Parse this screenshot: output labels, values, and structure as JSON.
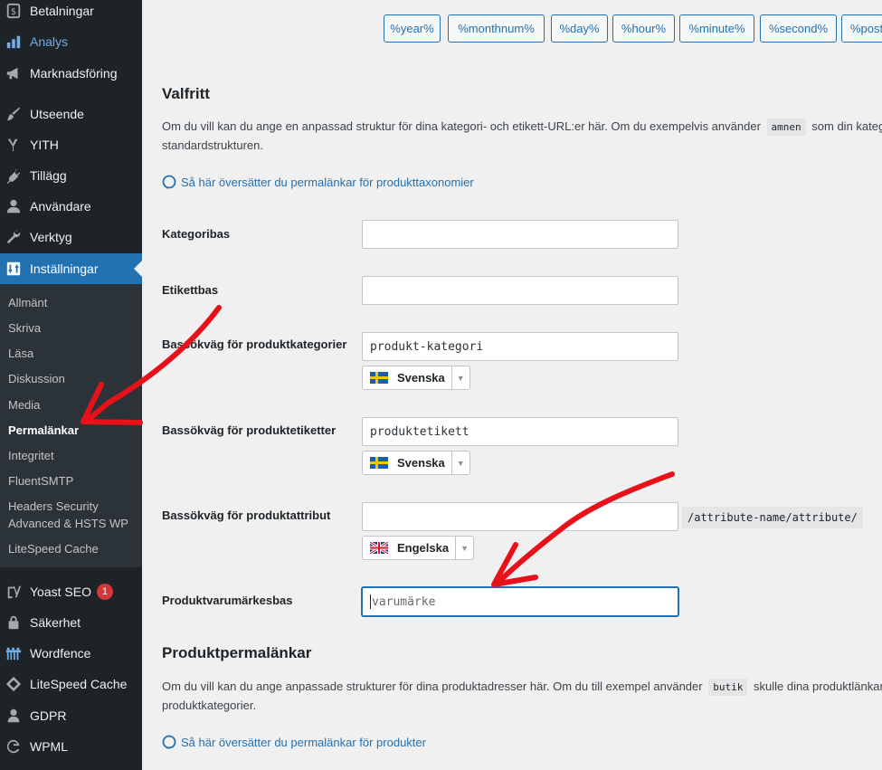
{
  "sidebar": {
    "top_items": [
      {
        "label": "Betalningar",
        "icon": "dollar-icon"
      },
      {
        "label": "Analys",
        "icon": "chart-bar-icon"
      },
      {
        "label": "Marknadsföring",
        "icon": "megaphone-icon"
      },
      {
        "label": "Utseende",
        "icon": "paintbrush-icon"
      },
      {
        "label": "YITH",
        "icon": "yith-icon"
      },
      {
        "label": "Tillägg",
        "icon": "plugin-icon"
      },
      {
        "label": "Användare",
        "icon": "users-icon"
      },
      {
        "label": "Verktyg",
        "icon": "wrench-icon"
      },
      {
        "label": "Inställningar",
        "icon": "settings-icon"
      }
    ],
    "submenu": [
      "Allmänt",
      "Skriva",
      "Läsa",
      "Diskussion",
      "Media",
      "Permalänkar",
      "Integritet",
      "FluentSMTP",
      "Headers Security Advanced & HSTS WP",
      "LiteSpeed Cache"
    ],
    "bottom_items": [
      {
        "label": "Yoast SEO",
        "icon": "yoast-icon",
        "badge": "1"
      },
      {
        "label": "Säkerhet",
        "icon": "lock-icon"
      },
      {
        "label": "Wordfence",
        "icon": "wordfence-icon"
      },
      {
        "label": "LiteSpeed Cache",
        "icon": "diamond-icon"
      },
      {
        "label": "GDPR",
        "icon": "person-icon"
      },
      {
        "label": "WPML",
        "icon": "wpml-icon"
      }
    ]
  },
  "tags": [
    "%year%",
    "%monthnum%",
    "%day%",
    "%hour%",
    "%minute%",
    "%second%",
    "%post"
  ],
  "optional": {
    "heading": "Valfritt",
    "desc_line1_before": "Om du vill kan du ange en anpassad struktur för dina kategori- och etikett-URL:er här. Om du exempelvis använder",
    "desc_code": "amnen",
    "desc_line1_after": "som din kateg",
    "desc_line2": "standardstrukturen.",
    "help_link": "Så här översätter du permalänkar för produkttaxonomier"
  },
  "fields": {
    "kategoribas": {
      "label": "Kategoribas",
      "value": ""
    },
    "etikettbas": {
      "label": "Etikettbas",
      "value": ""
    },
    "produktkategorier": {
      "label": "Bassökväg för produktkategorier",
      "value": "produkt-kategori",
      "language": "Svenska"
    },
    "produktetiketter": {
      "label": "Bassökväg för produktetiketter",
      "value": "produktetikett",
      "language": "Svenska"
    },
    "produktattribut": {
      "label": "Bassökväg för produktattribut",
      "value": "",
      "suffix": "/attribute-name/attribute/",
      "language": "Engelska"
    },
    "varumarke": {
      "label": "Produktvarumärkesbas",
      "placeholder": "varumärke"
    }
  },
  "product_permalinks": {
    "heading": "Produktpermalänkar",
    "desc_line1_before": "Om du vill kan du ange anpassade strukturer för dina produktadresser här. Om du till exempel använder",
    "desc_code": "butik",
    "desc_line1_after": "skulle dina produktlänkar",
    "desc_line2": "produktkategorier.",
    "help_link": "Så här översätter du permalänkar för produkter"
  },
  "colors": {
    "accent": "#2271b1",
    "sidebar": "#1d2327",
    "annotation": "#e8111a"
  }
}
